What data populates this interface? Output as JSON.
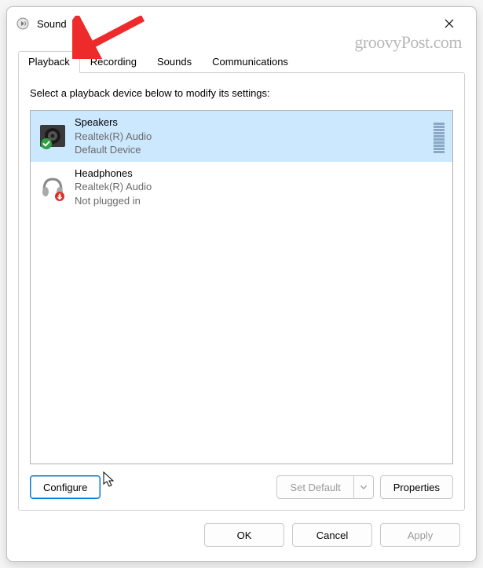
{
  "window": {
    "title": "Sound"
  },
  "watermark": "groovyPost.com",
  "tabs": {
    "items": [
      {
        "label": "Playback",
        "active": true
      },
      {
        "label": "Recording",
        "active": false
      },
      {
        "label": "Sounds",
        "active": false
      },
      {
        "label": "Communications",
        "active": false
      }
    ]
  },
  "panel": {
    "instruction": "Select a playback device below to modify its settings:"
  },
  "devices": [
    {
      "name": "Speakers",
      "driver": "Realtek(R) Audio",
      "status": "Default Device",
      "selected": true,
      "badge": "default"
    },
    {
      "name": "Headphones",
      "driver": "Realtek(R) Audio",
      "status": "Not plugged in",
      "selected": false,
      "badge": "unplugged"
    }
  ],
  "buttons": {
    "configure": "Configure",
    "set_default": "Set Default",
    "properties": "Properties",
    "ok": "OK",
    "cancel": "Cancel",
    "apply": "Apply"
  }
}
